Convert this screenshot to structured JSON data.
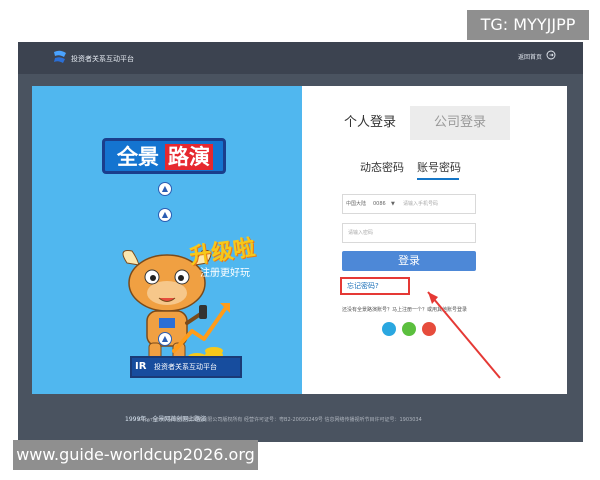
{
  "badge": "TG: MYYJJPP",
  "watermark": "www.guide-worldcup2026.org",
  "app": {
    "brand": "投资者关系互动平台",
    "home_link": "返回首页"
  },
  "left": {
    "logo_part1": "全景",
    "logo_part2": "路演",
    "upgrade_title": "升级啦",
    "upgrade_sub": "注册更好玩",
    "irplatform_icon": "IR",
    "irplatform_label": "投资者关系互动平台",
    "footnote": "1999年，全景网首创网上路演"
  },
  "login": {
    "tab_person": "个人登录",
    "tab_company": "公司登录",
    "subtab_dynamic": "动态密码",
    "subtab_account": "账号密码",
    "region": "中国大陆",
    "code": "0086",
    "phone_placeholder": "请输入手机号码",
    "password_placeholder": "请输入密码",
    "login_button": "登录",
    "forgot": "忘记密码?",
    "other_login": "还没有全景路演账号？马上注册一个？或用其他账号登录"
  },
  "footer": {
    "copyright": "Copyright©深圳市全景网络有限公司版权所有 经营许可证号：粤B2-20050249号 信息网络传播视听节目许可证号：1903034"
  },
  "colors": {
    "left_panel": "#50b7ef",
    "login_button": "#4d88d7",
    "highlight": "#e53935"
  }
}
